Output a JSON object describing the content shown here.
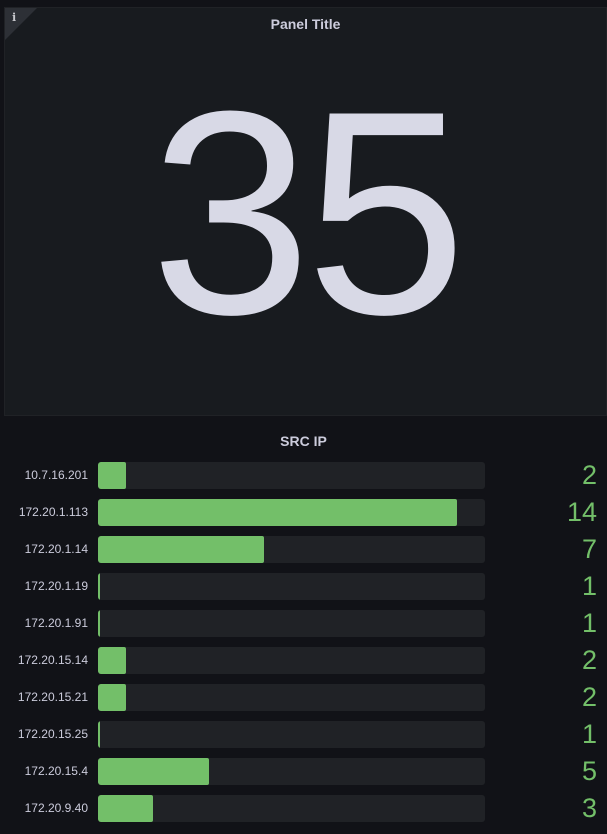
{
  "stat_panel": {
    "title": "Panel Title",
    "info_icon": "info-icon",
    "value": "35"
  },
  "bar_panel": {
    "title": "SRC IP",
    "accent_color": "#73bf69",
    "max": 15,
    "rows": [
      {
        "label": "10.7.16.201",
        "value": 2
      },
      {
        "label": "172.20.1.113",
        "value": 14
      },
      {
        "label": "172.20.1.14",
        "value": 7
      },
      {
        "label": "172.20.1.19",
        "value": 1
      },
      {
        "label": "172.20.1.91",
        "value": 1
      },
      {
        "label": "172.20.15.14",
        "value": 2
      },
      {
        "label": "172.20.15.21",
        "value": 2
      },
      {
        "label": "172.20.15.25",
        "value": 1
      },
      {
        "label": "172.20.15.4",
        "value": 5
      },
      {
        "label": "172.20.9.40",
        "value": 3
      }
    ]
  }
}
